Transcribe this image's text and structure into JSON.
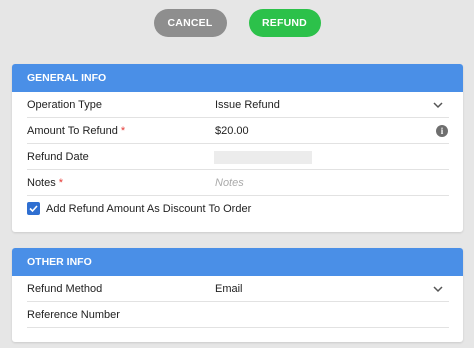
{
  "actions": {
    "cancel_label": "CANCEL",
    "refund_label": "REFUND"
  },
  "general_info": {
    "title": "GENERAL INFO",
    "operation_type": {
      "label": "Operation Type",
      "value": "Issue Refund"
    },
    "amount_to_refund": {
      "label": "Amount To Refund",
      "required_mark": "*",
      "value": "$20.00"
    },
    "refund_date": {
      "label": "Refund Date",
      "value": ""
    },
    "notes": {
      "label": "Notes",
      "required_mark": "*",
      "placeholder": "Notes"
    },
    "discount_checkbox": {
      "label": "Add Refund Amount As Discount To Order",
      "checked": true
    }
  },
  "other_info": {
    "title": "OTHER INFO",
    "refund_method": {
      "label": "Refund Method",
      "value": "Email"
    },
    "reference_number": {
      "label": "Reference Number",
      "value": ""
    }
  },
  "colors": {
    "header_blue": "#4a8fe7",
    "refund_green": "#2cc14a",
    "cancel_gray": "#8e8e8e",
    "required_red": "#e53935",
    "checkbox_blue": "#2f6fd1"
  }
}
